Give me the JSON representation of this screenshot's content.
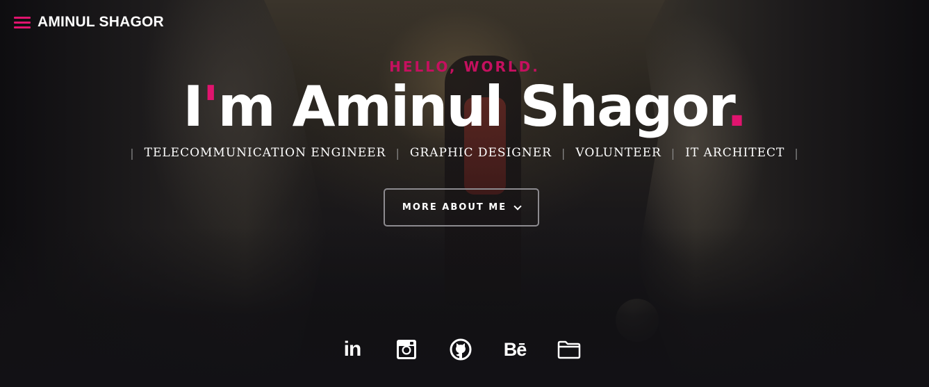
{
  "header": {
    "brand": "AMINUL SHAGOR"
  },
  "hero": {
    "greeting": "HELLO, WORLD.",
    "headline_prefix": "I",
    "headline_apostrophe": "'",
    "headline_main": "m Aminul Shagor",
    "headline_dot": ".",
    "roles": [
      "TELECOMMUNICATION ENGINEER",
      "GRAPHIC DESIGNER",
      "VOLUNTEER",
      "IT ARCHITECT"
    ],
    "separator": "|",
    "more_button_label": "MORE ABOUT ME"
  },
  "socials": {
    "linkedin_glyph": "in",
    "behance_glyph": "Bē",
    "icons": [
      "linkedin-icon",
      "instagram-icon",
      "github-icon",
      "behance-icon",
      "folder-icon"
    ]
  },
  "colors": {
    "accent": "#e0146e",
    "greeting": "#c5105f",
    "text": "#ffffff",
    "background": "#111014"
  }
}
